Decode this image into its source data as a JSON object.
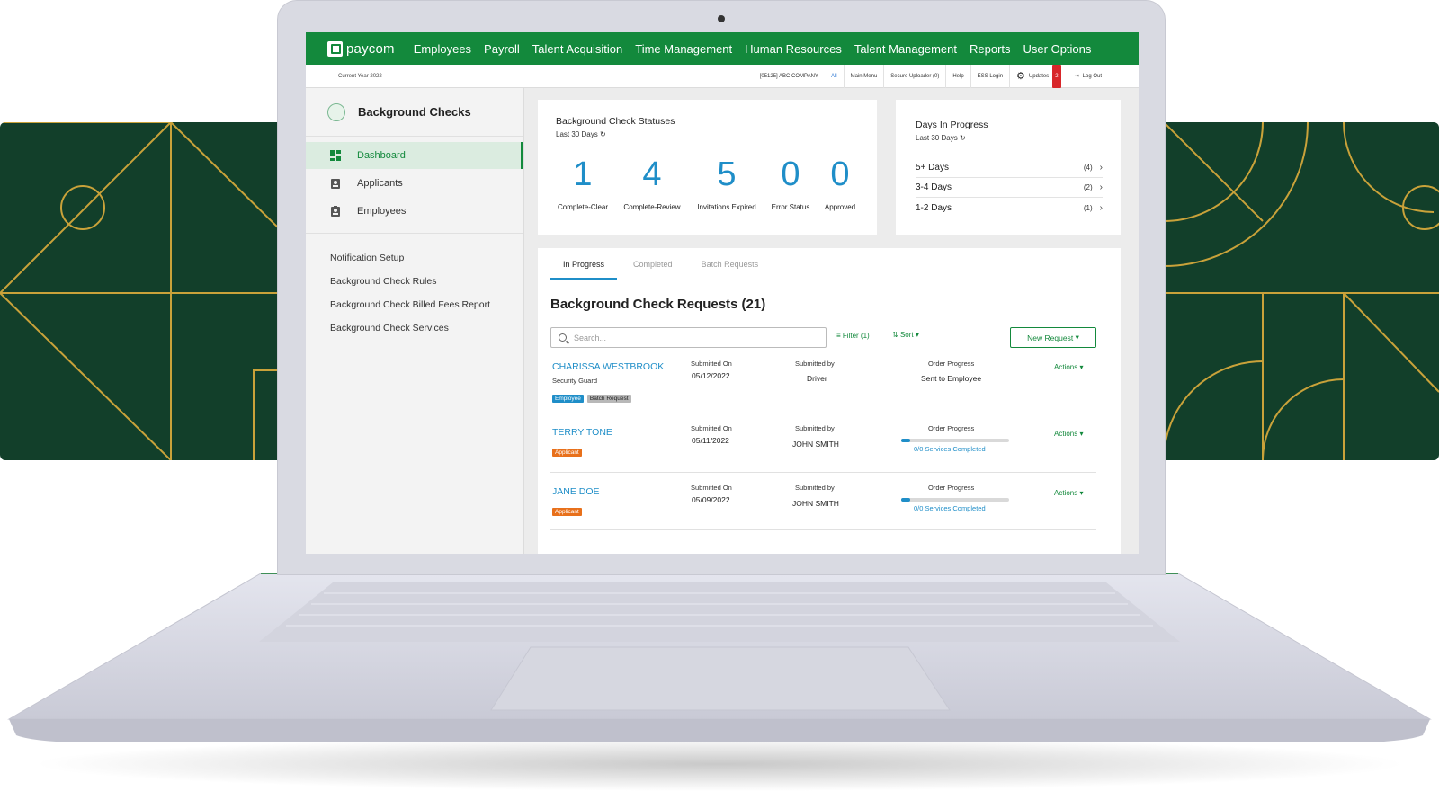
{
  "nav": {
    "logo": "paycom",
    "items": [
      "Employees",
      "Payroll",
      "Talent Acquisition",
      "Time Management",
      "Human Resources",
      "Talent Management",
      "Reports",
      "User Options"
    ]
  },
  "subbar": {
    "current_year": "Current Year 2022",
    "company": "[05125] ABC COMPANY",
    "all": "All",
    "main_menu": "Main Menu",
    "secure_uploader": "Secure Uploader (0)",
    "help": "Help",
    "ess_login": "ESS Login",
    "updates": "Updates",
    "updates_count": "2",
    "logout": "Log Out"
  },
  "sidebar": {
    "title": "Background Checks",
    "nav": [
      {
        "label": "Dashboard",
        "icon": "dashboard-icon",
        "active": true
      },
      {
        "label": "Applicants",
        "icon": "applicant-icon",
        "active": false
      },
      {
        "label": "Employees",
        "icon": "employee-icon",
        "active": false
      }
    ],
    "links": [
      "Notification Setup",
      "Background Check Rules",
      "Background Check Billed Fees Report",
      "Background Check Services"
    ]
  },
  "statuses": {
    "title": "Background Check Statuses",
    "period": "Last 30 Days",
    "items": [
      {
        "value": "1",
        "label": "Complete-Clear"
      },
      {
        "value": "4",
        "label": "Complete-Review"
      },
      {
        "value": "5",
        "label": "Invitations Expired"
      },
      {
        "value": "0",
        "label": "Error Status"
      },
      {
        "value": "0",
        "label": "Approved"
      }
    ]
  },
  "days": {
    "title": "Days In Progress",
    "period": "Last 30 Days",
    "rows": [
      {
        "label": "5+ Days",
        "count": "(4)"
      },
      {
        "label": "3-4 Days",
        "count": "(2)"
      },
      {
        "label": "1-2 Days",
        "count": "(1)"
      }
    ]
  },
  "requests": {
    "tabs": [
      "In Progress",
      "Completed",
      "Batch Requests"
    ],
    "title": "Background Check Requests (21)",
    "search_placeholder": "Search...",
    "filter": "Filter (1)",
    "sort": "Sort",
    "new_request": "New Request",
    "col_submitted_on": "Submitted On",
    "col_submitted_by": "Submitted by",
    "col_progress": "Order Progress",
    "actions": "Actions",
    "rows": [
      {
        "name": "CHARISSA WESTBROOK",
        "role": "Security Guard",
        "tags": [
          "Employee",
          "Batch Request"
        ],
        "date": "05/12/2022",
        "by": "Driver",
        "progress_text": "Sent to Employee",
        "progress_fraction": null
      },
      {
        "name": "TERRY TONE",
        "role": "",
        "tags": [
          "Applicant"
        ],
        "date": "05/11/2022",
        "by": "JOHN SMITH",
        "progress_text": "0/0 Services Completed",
        "progress_fraction": 0.08
      },
      {
        "name": "JANE DOE",
        "role": "",
        "tags": [
          "Applicant"
        ],
        "date": "05/09/2022",
        "by": "JOHN SMITH",
        "progress_text": "0/0 Services Completed",
        "progress_fraction": 0.08
      }
    ]
  },
  "colors": {
    "brand_green": "#13893c",
    "accent_blue": "#1f8ec8",
    "tag_orange": "#e8701b",
    "deco_green": "#123f2a",
    "deco_gold": "#c9a23a"
  }
}
